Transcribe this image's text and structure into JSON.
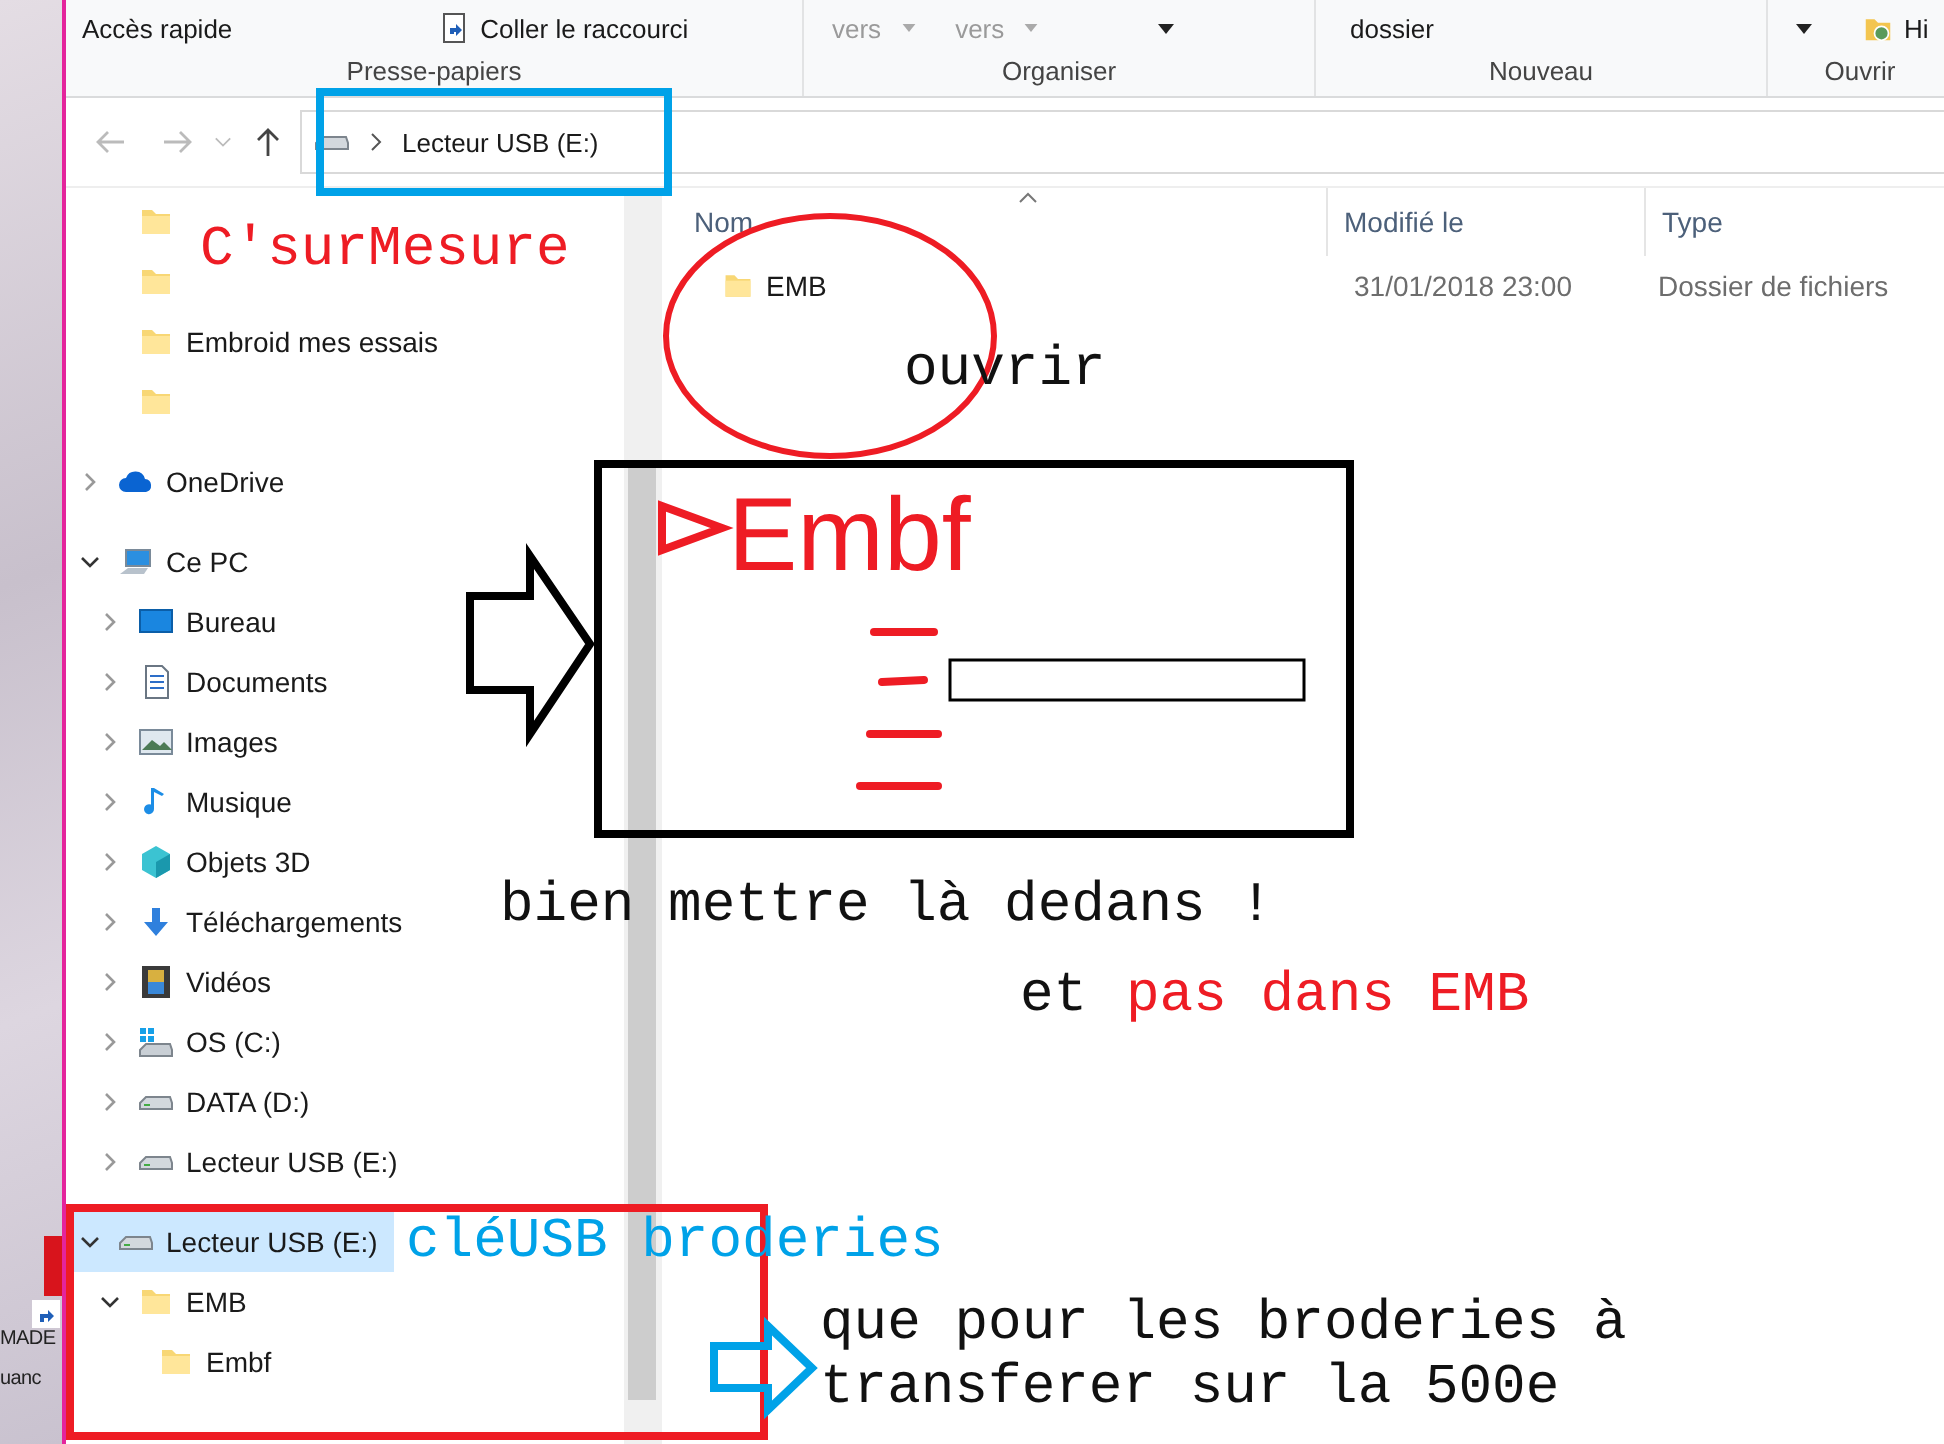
{
  "desktop": {
    "labels": [
      "MADE",
      "uanc"
    ]
  },
  "ribbon": {
    "groups": [
      {
        "label": "Presse-papiers",
        "items": [
          {
            "kind": "text",
            "text": "Accès rapide",
            "disabled": false
          },
          {
            "kind": "shortcut",
            "text": "Coller le raccourci",
            "disabled": false
          }
        ]
      },
      {
        "label": "Organiser",
        "items": [
          {
            "kind": "dropdown",
            "text": "vers",
            "disabled": true
          },
          {
            "kind": "dropdown",
            "text": "vers",
            "disabled": true
          },
          {
            "kind": "caret"
          }
        ]
      },
      {
        "label": "Nouveau",
        "items": [
          {
            "kind": "text",
            "text": "dossier",
            "disabled": false
          }
        ]
      },
      {
        "label": "Ouvrir",
        "items": [
          {
            "kind": "caret"
          },
          {
            "kind": "history",
            "text": "Hi",
            "disabled": false
          }
        ]
      }
    ]
  },
  "address_bar": {
    "path": "Lecteur USB (E:)"
  },
  "nav": {
    "quick_items": [
      {
        "kind": "folder"
      },
      {
        "kind": "folder"
      },
      {
        "kind": "folder",
        "label": "Embroid mes essais"
      },
      {
        "kind": "folder"
      }
    ],
    "tree": [
      {
        "kind": "cloud",
        "label": "OneDrive",
        "expanded": false,
        "selected": false
      },
      {
        "kind": "pc",
        "label": "Ce PC",
        "expanded": true,
        "selected": false,
        "children": [
          {
            "kind": "desktop",
            "label": "Bureau",
            "expanded": false,
            "selected": false
          },
          {
            "kind": "document",
            "label": "Documents",
            "expanded": false,
            "selected": false
          },
          {
            "kind": "image",
            "label": "Images",
            "expanded": false,
            "selected": false
          },
          {
            "kind": "music",
            "label": "Musique",
            "expanded": false,
            "selected": false
          },
          {
            "kind": "cube",
            "label": "Objets 3D",
            "expanded": false,
            "selected": false
          },
          {
            "kind": "download",
            "label": "Téléchargements",
            "expanded": false,
            "selected": false
          },
          {
            "kind": "video",
            "label": "Vidéos",
            "expanded": false,
            "selected": false
          },
          {
            "kind": "osdrive",
            "label": "OS (C:)",
            "expanded": false,
            "selected": false
          },
          {
            "kind": "drive",
            "label": "DATA (D:)",
            "expanded": false,
            "selected": false
          },
          {
            "kind": "drive",
            "label": "Lecteur USB (E:)",
            "expanded": false,
            "selected": false
          }
        ]
      },
      {
        "kind": "drive",
        "label": "Lecteur USB (E:)",
        "expanded": true,
        "selected": true,
        "children": [
          {
            "kind": "folder",
            "label": "EMB",
            "expanded": true,
            "selected": false,
            "children": [
              {
                "kind": "folder",
                "label": "Embf",
                "selected": false
              }
            ]
          }
        ]
      }
    ]
  },
  "file_list": {
    "columns": [
      "Nom",
      "Modifié le",
      "Type"
    ],
    "rows": [
      {
        "name": "EMB",
        "modified": "31/01/2018 23:00",
        "type": "Dossier de fichiers"
      }
    ]
  },
  "annotations": {
    "title_note": "C'surMesure",
    "open_note": "ouvrir",
    "sketch_title": "Embf",
    "instruction": "bien mettre là dedans !",
    "warning_lead": "et",
    "warning": "pas dans EMB",
    "usb_note": "cléUSB broderies",
    "purpose_note": "que pour les broderies à transferer sur la 500e"
  }
}
